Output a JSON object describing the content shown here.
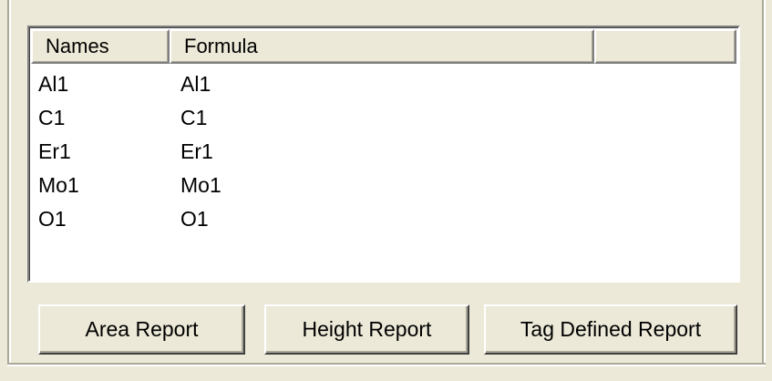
{
  "list": {
    "columns": [
      "Names",
      "Formula",
      ""
    ],
    "rows": [
      {
        "name": "Al1",
        "formula": "Al1"
      },
      {
        "name": "C1",
        "formula": "C1"
      },
      {
        "name": "Er1",
        "formula": "Er1"
      },
      {
        "name": "Mo1",
        "formula": "Mo1"
      },
      {
        "name": "O1",
        "formula": "O1"
      }
    ]
  },
  "buttons": {
    "area_report": "Area Report",
    "height_report": "Height Report",
    "tag_defined_report": "Tag Defined Report"
  },
  "colors": {
    "panel_background": "#ece9d8",
    "list_background": "#ffffff",
    "text": "#000000"
  }
}
